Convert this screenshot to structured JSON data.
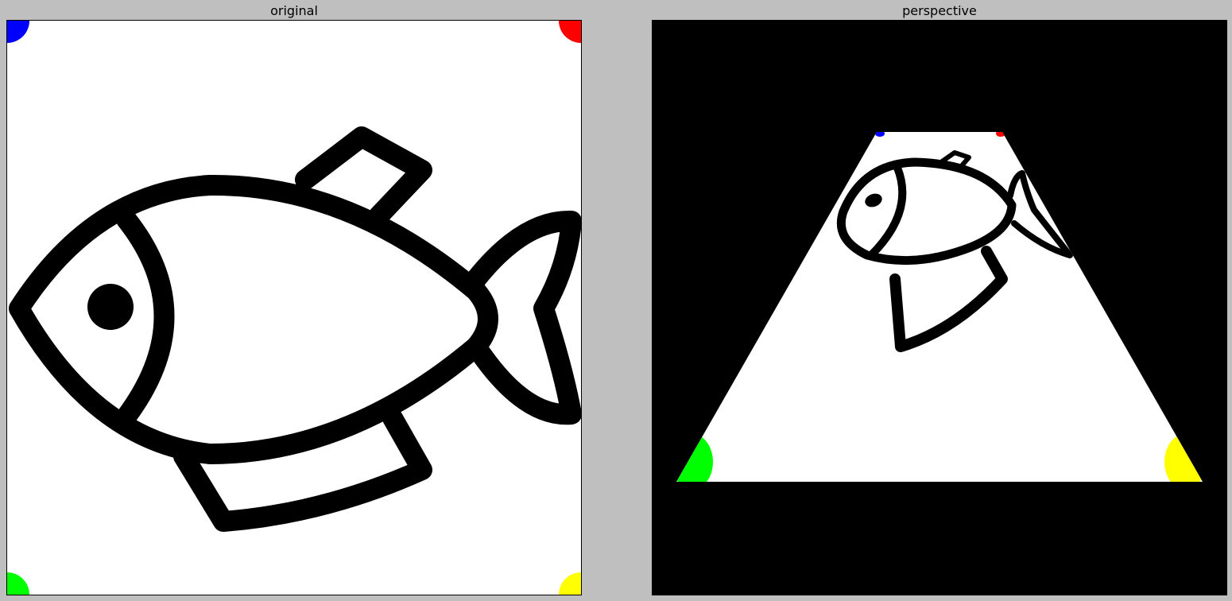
{
  "panels": [
    {
      "title": "original"
    },
    {
      "title": "perspective"
    }
  ],
  "corner_markers": {
    "top_left": "#0000ff",
    "top_right": "#ff0000",
    "bottom_left": "#00ff00",
    "bottom_right": "#ffff00"
  },
  "colors": {
    "background": "#bfbfbf",
    "image_background": "#ffffff",
    "outside_region": "#000000",
    "stroke": "#000000"
  },
  "image_content": {
    "original": "fish-outline-icon",
    "perspective": "fish-outline-icon-perspective-warped"
  }
}
